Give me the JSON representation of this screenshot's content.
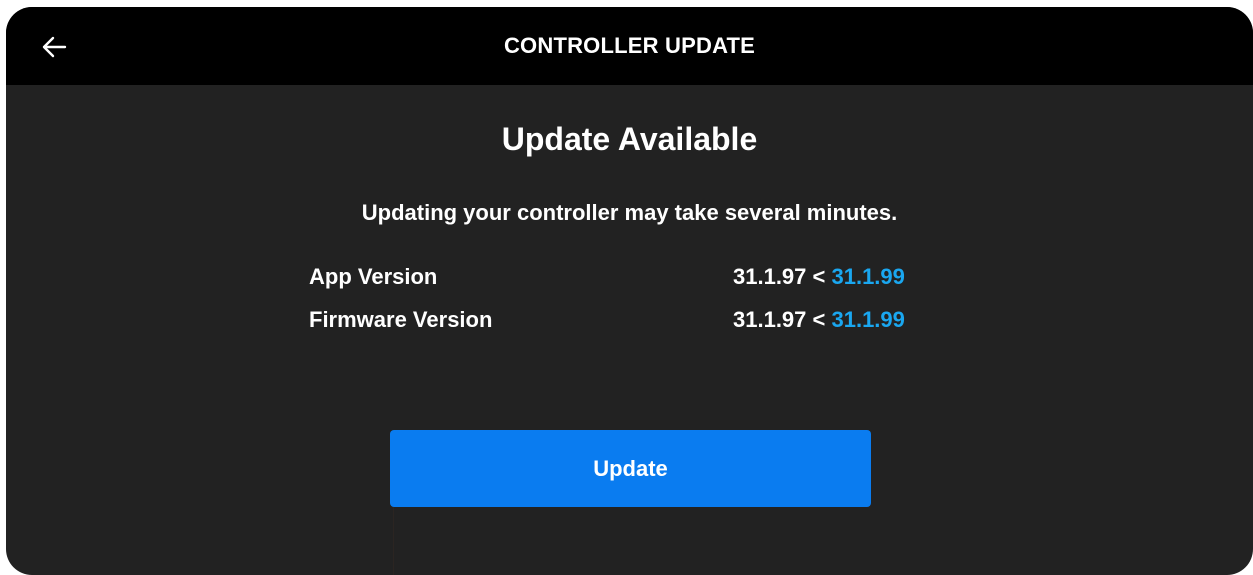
{
  "header": {
    "title": "CONTROLLER UPDATE",
    "back_icon": "arrow-left-icon"
  },
  "main": {
    "heading": "Update Available",
    "subtitle": "Updating your controller may take several minutes.",
    "versions": [
      {
        "label": "App Version",
        "current": "31.1.97",
        "separator": " < ",
        "available": "31.1.99"
      },
      {
        "label": "Firmware Version",
        "current": "31.1.97",
        "separator": " < ",
        "available": "31.1.99"
      }
    ],
    "update_button_label": "Update"
  },
  "colors": {
    "background": "#222222",
    "header_background": "#000000",
    "accent_version": "#1aa7f0",
    "button": "#0a7cf0",
    "text": "#ffffff"
  }
}
